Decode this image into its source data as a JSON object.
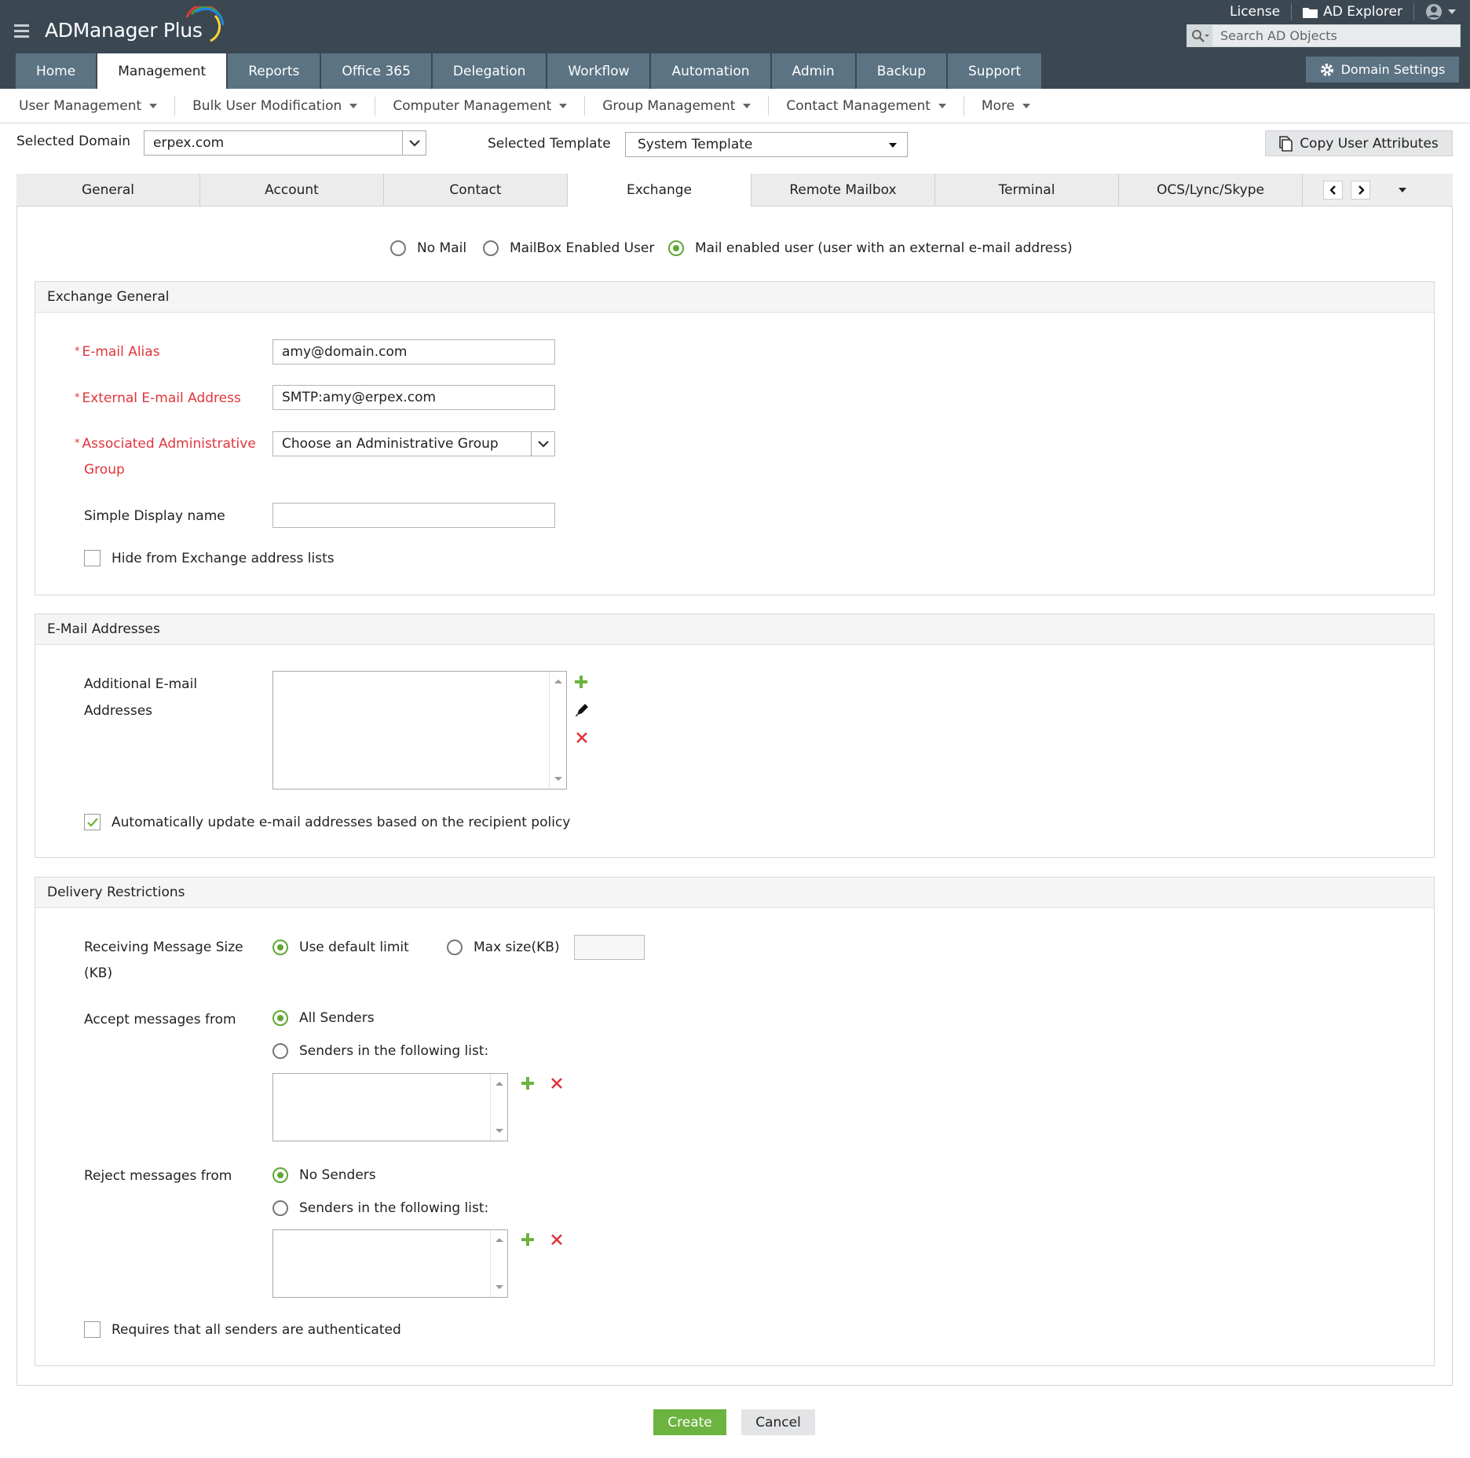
{
  "app": {
    "title": "ADManager Plus"
  },
  "top_links": {
    "license": "License",
    "ad_explorer": "AD Explorer"
  },
  "search": {
    "placeholder": "Search AD Objects"
  },
  "nav": {
    "tabs": [
      {
        "label": "Home"
      },
      {
        "label": "Management"
      },
      {
        "label": "Reports"
      },
      {
        "label": "Office 365"
      },
      {
        "label": "Delegation"
      },
      {
        "label": "Workflow"
      },
      {
        "label": "Automation"
      },
      {
        "label": "Admin"
      },
      {
        "label": "Backup"
      },
      {
        "label": "Support"
      }
    ],
    "active": "Management",
    "domain_settings": "Domain Settings"
  },
  "subnav": {
    "items": [
      {
        "label": "User Management"
      },
      {
        "label": "Bulk User Modification"
      },
      {
        "label": "Computer Management"
      },
      {
        "label": "Group Management"
      },
      {
        "label": "Contact Management"
      },
      {
        "label": "More"
      }
    ]
  },
  "selection": {
    "domain_label": "Selected Domain",
    "domain_value": "erpex.com",
    "template_label": "Selected Template",
    "template_value": "System Template",
    "copy_button": "Copy User Attributes"
  },
  "form_tabs": {
    "items": [
      {
        "label": "General"
      },
      {
        "label": "Account"
      },
      {
        "label": "Contact"
      },
      {
        "label": "Exchange"
      },
      {
        "label": "Remote Mailbox"
      },
      {
        "label": "Terminal"
      },
      {
        "label": "OCS/Lync/Skype"
      }
    ],
    "active": "Exchange"
  },
  "mail_type": {
    "options": [
      {
        "label": "No Mail",
        "selected": false
      },
      {
        "label": "MailBox Enabled User",
        "selected": false
      },
      {
        "label": "Mail enabled user (user with an external e-mail address)",
        "selected": true
      }
    ]
  },
  "exchange_general": {
    "title": "Exchange General",
    "email_alias_label": "E-mail Alias",
    "email_alias_value": "amy@domain.com",
    "external_email_label": "External E-mail Address",
    "external_email_value": "SMTP:amy@erpex.com",
    "admin_group_label_1": "Associated Administrative",
    "admin_group_label_2": "Group",
    "admin_group_value": "Choose an Administrative Group",
    "display_name_label": "Simple Display name",
    "display_name_value": "",
    "hide_label": "Hide from Exchange address lists",
    "hide_checked": false
  },
  "email_addresses": {
    "title": "E-Mail Addresses",
    "additional_label_1": "Additional E-mail",
    "additional_label_2": "Addresses",
    "auto_update_label": "Automatically update e-mail addresses based on the recipient policy",
    "auto_update_checked": true
  },
  "delivery": {
    "title": "Delivery Restrictions",
    "receiving_label_1": "Receiving Message Size",
    "receiving_label_2": "(KB)",
    "use_default": "Use default limit",
    "max_size": "Max size(KB)",
    "max_size_value": "",
    "accept_label": "Accept messages from",
    "all_senders": "All Senders",
    "senders_list": "Senders in the following list:",
    "reject_label": "Reject messages from",
    "no_senders": "No Senders",
    "authenticated_label": "Requires that all senders are authenticated",
    "authenticated_checked": false
  },
  "actions": {
    "create": "Create",
    "cancel": "Cancel"
  },
  "colors": {
    "header": "#3b4852",
    "nav_tab": "#5b7383",
    "accent_green": "#6cb33f",
    "required_red": "#e0353b"
  }
}
